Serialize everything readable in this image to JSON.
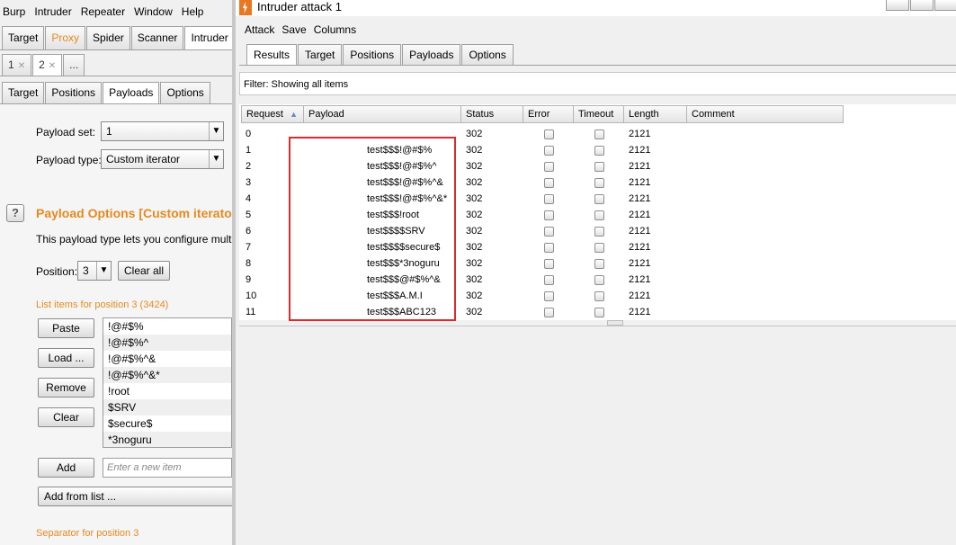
{
  "burp": {
    "menu": [
      "Burp",
      "Intruder",
      "Repeater",
      "Window",
      "Help"
    ],
    "main_tabs": [
      "Target",
      "Proxy",
      "Spider",
      "Scanner",
      "Intruder"
    ],
    "num_tabs": [
      {
        "label": "1"
      },
      {
        "label": "2"
      },
      {
        "label": "..."
      }
    ],
    "sub_tabs": [
      "Target",
      "Positions",
      "Payloads",
      "Options"
    ],
    "payload_set_label": "Payload set:",
    "payload_set_value": "1",
    "payload_type_label": "Payload type:",
    "payload_type_value": "Custom iterator",
    "section_title": "Payload Options [Custom iterator]",
    "section_desc": "This payload type lets you configure multiple",
    "position_label": "Position:",
    "position_value": "3",
    "clear_all": "Clear all",
    "list_items_label": "List items for position 3 (3424)",
    "buttons": {
      "paste": "Paste",
      "load": "Load ...",
      "remove": "Remove",
      "clear": "Clear",
      "add": "Add",
      "add_from_list": "Add from list ..."
    },
    "list_items": [
      "!@#$%",
      "!@#$%^",
      "!@#$%^&",
      "!@#$%^&*",
      "!root",
      "$SRV",
      "$secure$",
      "*3noguru"
    ],
    "new_item_placeholder": "Enter a new item",
    "separator_label": "Separator for position 3"
  },
  "attack": {
    "title": "Intruder attack 1",
    "menu": [
      "Attack",
      "Save",
      "Columns"
    ],
    "tabs": [
      "Results",
      "Target",
      "Positions",
      "Payloads",
      "Options"
    ],
    "filter": "Filter:  Showing all items",
    "columns": [
      "Request",
      "Payload",
      "Status",
      "Error",
      "Timeout",
      "Length",
      "Comment"
    ],
    "rows": [
      {
        "request": "0",
        "payload": "",
        "status": "302",
        "length": "2121"
      },
      {
        "request": "1",
        "payload": "test$$$!@#$%",
        "status": "302",
        "length": "2121"
      },
      {
        "request": "2",
        "payload": "test$$$!@#$%^",
        "status": "302",
        "length": "2121"
      },
      {
        "request": "3",
        "payload": "test$$$!@#$%^&",
        "status": "302",
        "length": "2121"
      },
      {
        "request": "4",
        "payload": "test$$$!@#$%^&*",
        "status": "302",
        "length": "2121"
      },
      {
        "request": "5",
        "payload": "test$$$!root",
        "status": "302",
        "length": "2121"
      },
      {
        "request": "6",
        "payload": "test$$$$SRV",
        "status": "302",
        "length": "2121"
      },
      {
        "request": "7",
        "payload": "test$$$$secure$",
        "status": "302",
        "length": "2121"
      },
      {
        "request": "8",
        "payload": "test$$$*3noguru",
        "status": "302",
        "length": "2121"
      },
      {
        "request": "9",
        "payload": "test$$$@#$%^&",
        "status": "302",
        "length": "2121"
      },
      {
        "request": "10",
        "payload": "test$$$A.M.I",
        "status": "302",
        "length": "2121"
      },
      {
        "request": "11",
        "payload": "test$$$ABC123",
        "status": "302",
        "length": "2121"
      }
    ]
  },
  "colors": {
    "accent_orange": "#e58a1f",
    "highlight_red": "#e0292a"
  }
}
